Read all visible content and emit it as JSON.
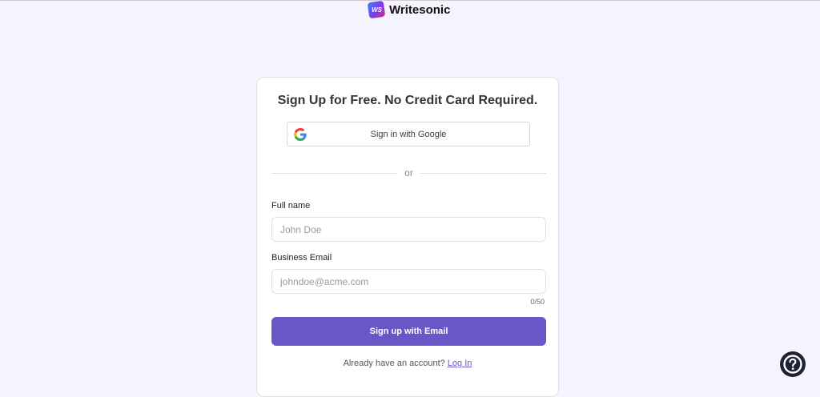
{
  "brand": {
    "logo_text": "WS",
    "name": "Writesonic"
  },
  "signup": {
    "title": "Sign Up for Free. No Credit Card Required.",
    "google_button_label": "Sign in with Google",
    "divider_text": "or",
    "full_name_label": "Full name",
    "full_name_placeholder": "John Doe",
    "email_label": "Business Email",
    "email_placeholder": "johndoe@acme.com",
    "email_counter": "0/50",
    "submit_label": "Sign up with Email",
    "login_prompt": "Already have an account?",
    "login_link": "Log In"
  },
  "colors": {
    "background": "#f5f3fe",
    "primary": "#6a57c7",
    "help_button": "#1c2135"
  },
  "icons": {
    "google": "google-g-icon",
    "help": "question-circle-icon"
  }
}
